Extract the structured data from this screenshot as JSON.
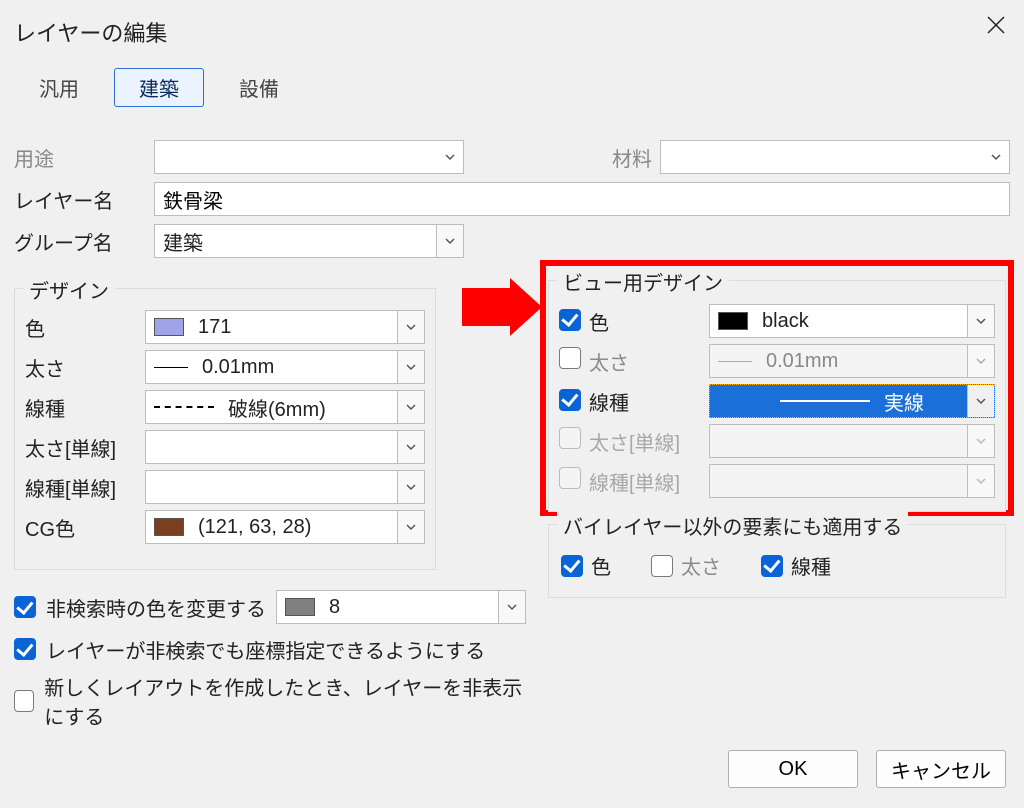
{
  "window": {
    "title": "レイヤーの編集"
  },
  "tabs": {
    "general": "汎用",
    "building": "建築",
    "equipment": "設備",
    "active_index": 1
  },
  "fields": {
    "usage_label": "用途",
    "usage_value": "",
    "material_label": "材料",
    "material_value": "",
    "layer_name_label": "レイヤー名",
    "layer_name_value": "鉄骨梁",
    "group_name_label": "グループ名",
    "group_name_value": "建築"
  },
  "design": {
    "group_title": "デザイン",
    "color_label": "色",
    "color_value": "171",
    "thickness_label": "太さ",
    "thickness_value": "0.01mm",
    "linetype_label": "線種",
    "linetype_value": "破線(6mm)",
    "thickness_single_label": "太さ[単線]",
    "thickness_single_value": "",
    "linetype_single_label": "線種[単線]",
    "linetype_single_value": "",
    "cgcolor_label": "CG色",
    "cgcolor_value": "(121, 63, 28)"
  },
  "view_design": {
    "group_title": "ビュー用デザイン",
    "color_checked": true,
    "color_label": "色",
    "color_value": "black",
    "thickness_checked": false,
    "thickness_label": "太さ",
    "thickness_value": "0.01mm",
    "linetype_checked": true,
    "linetype_label": "線種",
    "linetype_value": "実線",
    "thickness_single_label": "太さ[単線]",
    "linetype_single_label": "線種[単線]"
  },
  "bylayer": {
    "group_title": "バイレイヤー以外の要素にも適用する",
    "color_checked": true,
    "color_label": "色",
    "thickness_checked": false,
    "thickness_label": "太さ",
    "linetype_checked": true,
    "linetype_label": "線種"
  },
  "options": {
    "change_color_nonsearch_checked": true,
    "change_color_nonsearch_label": "非検索時の色を変更する",
    "change_color_nonsearch_value": "8",
    "allow_coord_checked": true,
    "allow_coord_label": "レイヤーが非検索でも座標指定できるようにする",
    "hide_on_new_layout_checked": false,
    "hide_on_new_layout_label": "新しくレイアウトを作成したとき、レイヤーを非表示にする"
  },
  "buttons": {
    "ok": "OK",
    "cancel": "キャンセル"
  }
}
